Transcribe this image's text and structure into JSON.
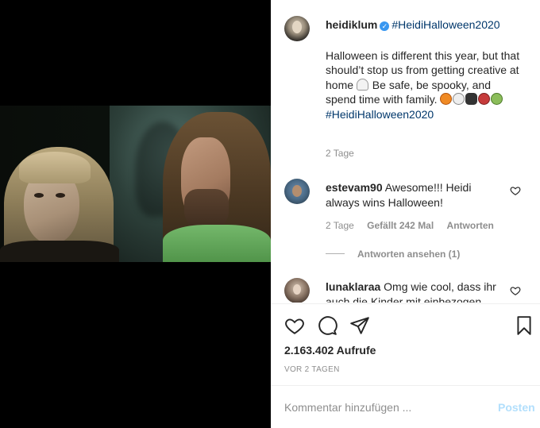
{
  "post": {
    "author": "heidiklum",
    "header_hashtag": "#HeidiHalloween2020",
    "caption_text": "Halloween is different this year, but that should’t stop us from getting creative at home",
    "caption_text_2": " Be safe, be spooky, and spend time with family. ",
    "caption_hashtag": "#HeidiHalloween2020",
    "caption_time": "2 Tage",
    "emojis": [
      "ghost",
      "pumpkin",
      "skull",
      "bat",
      "vampire",
      "zombie"
    ]
  },
  "comments": [
    {
      "user": "estevam90",
      "text": "Awesome!!! Heidi always wins Halloween!",
      "time": "2 Tage",
      "likes": "Gefällt 242 Mal",
      "reply": "Antworten",
      "view_replies": "Antworten ansehen (1)"
    },
    {
      "user": "lunaklaraa",
      "text": "Omg wie cool, dass ihr auch die Kinder mit einbezogen"
    }
  ],
  "stats": {
    "views": "2.163.402 Aufrufe",
    "date": "VOR 2 TAGEN"
  },
  "composer": {
    "placeholder": "Kommentar hinzufügen ...",
    "post_label": "Posten"
  },
  "colors": {
    "link": "#00376b",
    "verified": "#3897f0",
    "secondary_text": "#8e8e8e",
    "post_button": "#b2dffc"
  }
}
